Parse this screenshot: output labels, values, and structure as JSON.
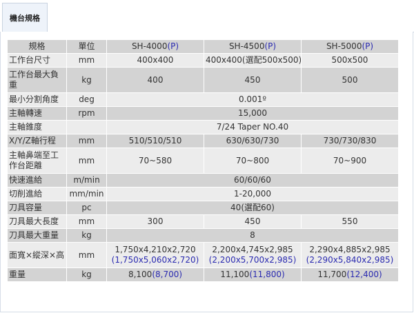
{
  "tab": {
    "label": "機台規格"
  },
  "header": {
    "label": "規格",
    "unit": "單位",
    "models": [
      {
        "name": "SH-4000",
        "suffix": "(P)"
      },
      {
        "name": "SH-4500",
        "suffix": "(P)"
      },
      {
        "name": "SH-5000",
        "suffix": "(P)"
      }
    ]
  },
  "rows": {
    "table_size": {
      "label": "工作台尺寸",
      "unit": "mm",
      "v1": "400x400",
      "v2": "400x400(選配500x500)",
      "v3": "500x500"
    },
    "max_load": {
      "label": "工作台最大負重",
      "unit": "kg",
      "v1": "400",
      "v2": "450",
      "v3": "500"
    },
    "min_index": {
      "label": "最小分割角度",
      "unit": "deg",
      "value": "0.001º"
    },
    "spindle_speed": {
      "label": "主軸轉速",
      "unit": "rpm",
      "value": "15,000"
    },
    "spindle_taper": {
      "label": "主軸錐度",
      "unit": "",
      "value": "7/24 Taper NO.40"
    },
    "xyz_travel": {
      "label": "X/Y/Z軸行程",
      "unit": "mm",
      "v1": "510/510/510",
      "v2": "630/630/730",
      "v3": "730/730/830"
    },
    "nose_to_table": {
      "label": "主軸鼻端至工作台距離",
      "unit": "mm",
      "v1": "70~580",
      "v2": "70~800",
      "v3": "70~900"
    },
    "rapid_feed": {
      "label": "快速進給",
      "unit": "m/min",
      "value": "60/60/60"
    },
    "cutting_feed": {
      "label": "切削進給",
      "unit": "mm/min",
      "value": "1-20,000"
    },
    "tool_capacity": {
      "label": "刀具容量",
      "unit": "pc",
      "value": "40(選配60)"
    },
    "max_tool_length": {
      "label": "刀具最大長度",
      "unit": "mm",
      "v1": "300",
      "v2": "450",
      "v3": "550"
    },
    "max_tool_weight": {
      "label": "刀具最大重量",
      "unit": "kg",
      "value": "8"
    },
    "dimensions": {
      "label": "面寬×縱深×高",
      "unit": "mm",
      "v1": "1,750x4,210x2,720",
      "v1p": "(1,750x5,060x2,720)",
      "v2": "2,200x4,745x2,985",
      "v2p": "(2,200x5,700x2,985)",
      "v3": "2,290x4,885x2,985",
      "v3p": "(2,290x5,840x2,985)"
    },
    "weight": {
      "label": "重量",
      "unit": "kg",
      "v1": "8,100",
      "v1p": "(8,700)",
      "v2": "11,100",
      "v2p": "(11,800)",
      "v3": "11,700",
      "v3p": "(12,400)"
    }
  },
  "colors": {
    "row_dark": "#d3d3d3",
    "row_light": "#ececec",
    "accent_blue": "#2a2ab0"
  }
}
